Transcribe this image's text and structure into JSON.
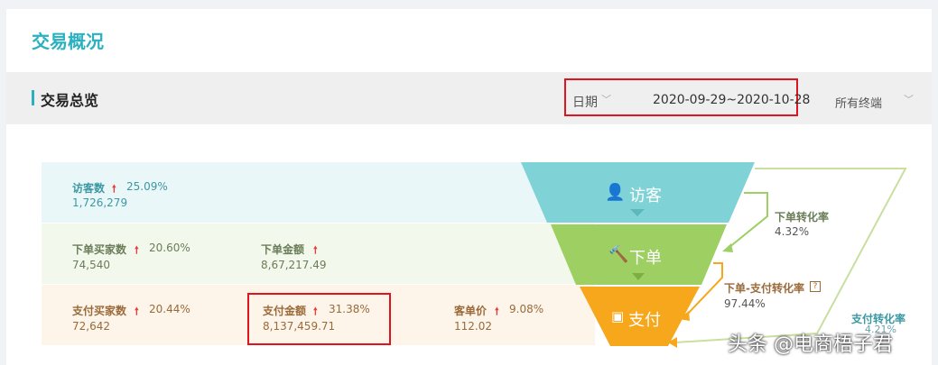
{
  "page": {
    "title": "交易概况"
  },
  "section": {
    "title": "交易总览"
  },
  "filters": {
    "date_label": "日期",
    "date_range": "2020-09-29~2020-10-28",
    "terminal_label": "所有终端"
  },
  "visitors": {
    "label": "访客数",
    "change": "25.09%",
    "value": "1,726,279"
  },
  "order_buyers": {
    "label": "下单买家数",
    "change": "20.60%",
    "value": "74,540"
  },
  "order_amount": {
    "label": "下单金额",
    "value": "8,67,217.49"
  },
  "pay_buyers": {
    "label": "支付买家数",
    "change": "20.44%",
    "value": "72,642"
  },
  "pay_amount": {
    "label": "支付金额",
    "change": "31.38%",
    "value": "8,137,459.71"
  },
  "avg_price": {
    "label": "客单价",
    "change": "9.08%",
    "value": "112.02"
  },
  "funnel": {
    "stage1": "访客",
    "stage2": "下单",
    "stage3": "支付",
    "colors": {
      "visit": "#7fd3d6",
      "order": "#9dcf63",
      "pay": "#f7a71c"
    }
  },
  "rates": {
    "order_rate_label": "下单转化率",
    "order_rate_value": "4.32%",
    "order_pay_rate_label": "下单-支付转化率",
    "order_pay_rate_value": "97.44%",
    "pay_rate_label": "支付转化率",
    "pay_rate_value": "4.21%"
  },
  "watermark": "头条 @电商梧子君"
}
